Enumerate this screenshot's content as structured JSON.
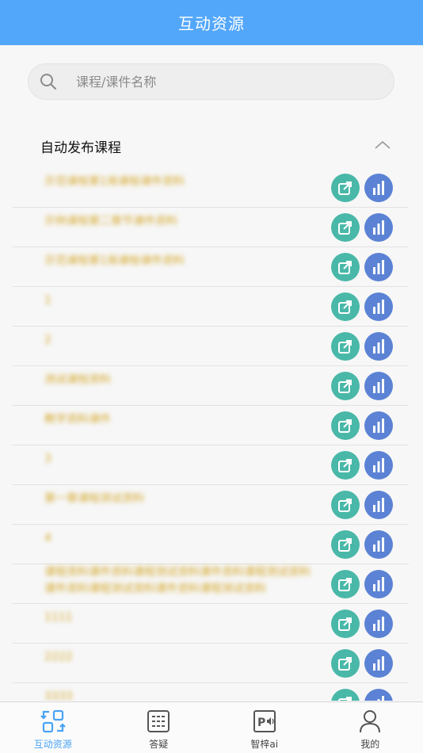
{
  "header": {
    "title": "互动资源"
  },
  "search": {
    "placeholder": "课程/课件名称",
    "value": ""
  },
  "section": {
    "title": "自动发布课程"
  },
  "rows": [
    {
      "name": "示范课程第1周课程课件资料"
    },
    {
      "name": "示例课程第二章节课件资料"
    },
    {
      "name": "示范课程第1周课程课件资料"
    },
    {
      "name": "1"
    },
    {
      "name": "2"
    },
    {
      "name": "测试课程资料"
    },
    {
      "name": "教学资料课件"
    },
    {
      "name": "3"
    },
    {
      "name": "第一章课程测试资料"
    },
    {
      "name": "4"
    },
    {
      "name": "课程资料课件资料课程测试资料课件资料课程测试资料课件资料课程测试资料课件资料课程测试资料",
      "double": true
    },
    {
      "name": "1111"
    },
    {
      "name": "2222"
    },
    {
      "name": "3333"
    }
  ],
  "tabs": [
    {
      "label": "互动资源",
      "icon": "interactive-resources-icon",
      "active": true
    },
    {
      "label": "答疑",
      "icon": "qa-grid-icon",
      "active": false
    },
    {
      "label": "智梓ai",
      "icon": "ppt-ai-icon",
      "active": false
    },
    {
      "label": "我的",
      "icon": "profile-icon",
      "active": false
    }
  ],
  "colors": {
    "header": "#53a7fb",
    "share": "#49b8a8",
    "stats": "#5b82d4",
    "active_tab": "#4aa3f5"
  }
}
